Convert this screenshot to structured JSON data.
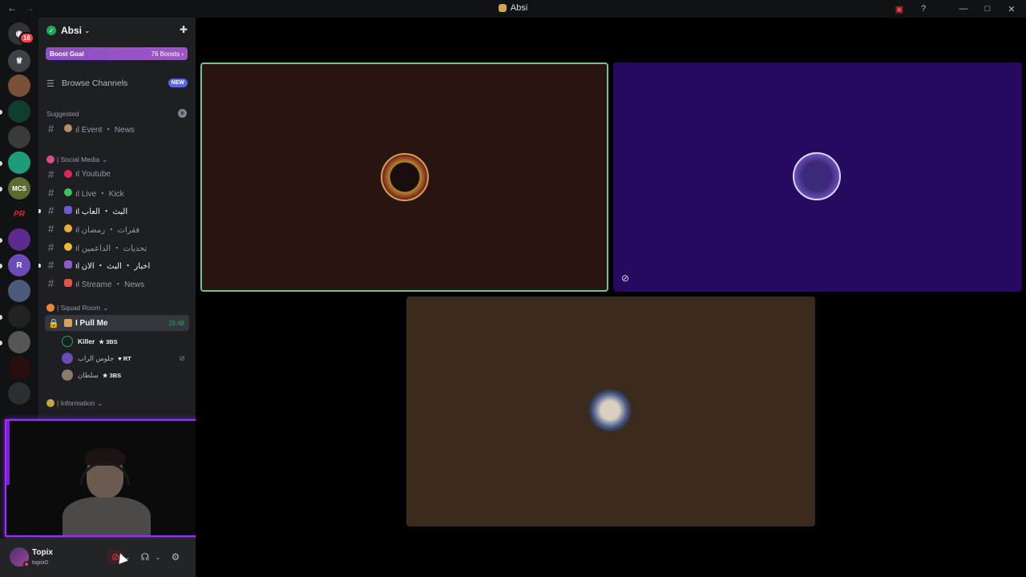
{
  "titlebar": {
    "title": "Absi",
    "nav": {
      "back_icon": "arrow-left",
      "forward_icon": "arrow-right"
    },
    "right_icons": [
      "screen-share-icon",
      "help-icon",
      "minimize-icon",
      "maximize-icon",
      "close-icon"
    ]
  },
  "rail": {
    "home_badge": "16"
  },
  "guild": {
    "name": "Absi",
    "boost_goal_label": "Boost Goal",
    "boost_count": "76 Boosts",
    "browse_channels": "Browse Channels",
    "new_badge": "NEW"
  },
  "categories": {
    "suggested": "Suggested",
    "social_media": "| Social Media",
    "squad_room": "| Squad Room",
    "information": "| Information"
  },
  "channels": {
    "event_news": "ıl Event ・ News",
    "youtube": "ıl Youtube",
    "live_kick": "ıl Live ・ Kick",
    "bait_games": "ıl البث ・ العاب",
    "ramadan": "ıl فقرات ・ رمضان",
    "challenges": "ıl تحديات ・ الداعمين",
    "now_live": "ıl اخبار ・ البث ・ الان",
    "streamer_news": "ıl Streame ・ News",
    "pull_me": "I Pull Me",
    "pull_me_timer": "29:48"
  },
  "voice_users": [
    {
      "name": "Killer",
      "tag": "3BS"
    },
    {
      "name": "جلوس الراب",
      "tag": "RT"
    },
    {
      "name": "سلطان",
      "tag": "3BS"
    }
  ],
  "user_panel": {
    "name": "Topix",
    "handle": "topix0"
  },
  "colors": {
    "tile1_bg": "#2a1412",
    "tile1_border": "#71c48a",
    "tile2_bg": "#250a5f",
    "tile3_bg": "#3a2b1c",
    "accent": "#5865f2"
  }
}
